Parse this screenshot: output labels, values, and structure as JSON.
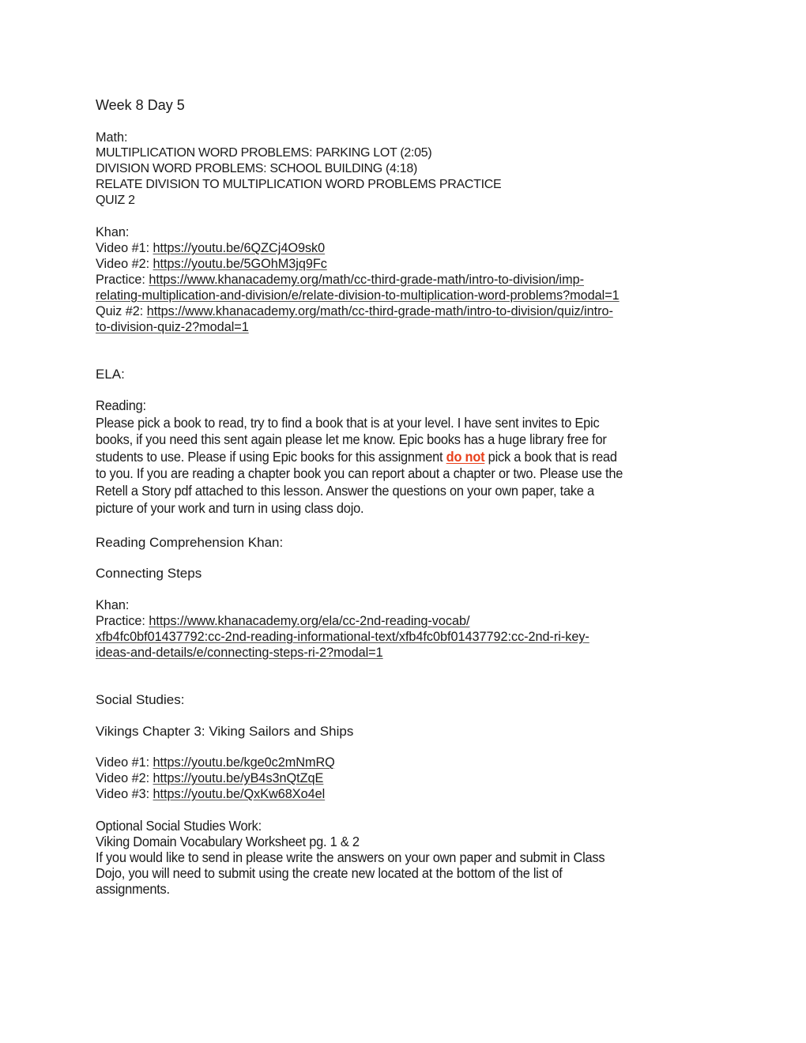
{
  "document": {
    "title": "Week 8 Day 5",
    "math": {
      "heading": "Math:",
      "items": [
        "MULTIPLICATION WORD PROBLEMS: PARKING LOT (2:05)",
        "DIVISION WORD PROBLEMS: SCHOOL BUILDING (4:18)",
        "RELATE DIVISION TO MULTIPLICATION WORD PROBLEMS PRACTICE",
        "QUIZ 2"
      ],
      "khan_heading": "Khan:",
      "video1_label": "Video #1: ",
      "video1_url": "https://youtu.be/6QZCj4O9sk0",
      "video2_label": "Video #2: ",
      "video2_url": "https://youtu.be/5GOhM3jq9Fc",
      "practice_label": "Practice: ",
      "practice_url_line1": "https://www.khanacademy.org/math/cc-third-grade-math/intro-to-division/imp-",
      "practice_url_line2": "relating-multiplication-and-division/e/relate-division-to-multiplication-word-problems?modal=1",
      "quiz_label": "Quiz #2: ",
      "quiz_url_line1": "https://www.khanacademy.org/math/cc-third-grade-math/intro-to-division/quiz/intro-",
      "quiz_url_line2": "to-division-quiz-2?modal=1"
    },
    "ela": {
      "heading": "ELA:",
      "reading_heading": "Reading:",
      "reading_lines": [
        "Please pick a book to read, try to find a book that is at your level. I have sent invites to Epic",
        "books, if you need this sent again please let me know. Epic books has a huge library free for"
      ],
      "reading_line3_before": "students to use. Please if using Epic books for this assignment ",
      "reading_emphasis": "do not",
      "reading_line3_after": " pick a book that is read",
      "reading_lines_end": [
        "to you. If you are reading a chapter book you can report about a chapter or two. Please use the",
        "Retell a Story pdf attached to this lesson. Answer the questions on your own paper, take a",
        "picture of your work and turn in using class dojo."
      ],
      "comprehension_heading": "Reading Comprehension Khan:",
      "topic": "Connecting Steps",
      "khan_heading": "Khan:",
      "practice_label": "Practice: ",
      "practice_url_line1": "https://www.khanacademy.org/ela/cc-2nd-reading-vocab/",
      "practice_url_line2": "xfb4fc0bf01437792:cc-2nd-reading-informational-text/xfb4fc0bf01437792:cc-2nd-ri-key-",
      "practice_url_line3": "ideas-and-details/e/connecting-steps-ri-2?modal=1"
    },
    "social_studies": {
      "heading": "Social Studies:",
      "chapter": "Vikings Chapter 3: Viking Sailors and Ships",
      "video1_label": "Video #1: ",
      "video1_url": "https://youtu.be/kge0c2mNmRQ",
      "video2_label": "Video #2: ",
      "video2_url": "https://youtu.be/yB4s3nQtZqE",
      "video3_label": "Video #3: ",
      "video3_url": "https://youtu.be/QxKw68Xo4el",
      "optional_heading": "Optional Social Studies Work:",
      "worksheet": "Viking Domain Vocabulary Worksheet pg. 1 & 2",
      "instructions_lines": [
        "If you would like to send in please write the answers on your own paper and submit in Class",
        "Dojo, you will need to submit using the create new located at the bottom of the list of",
        "assignments."
      ]
    },
    "colors": {
      "emphasis": "#e8401c",
      "text": "#1a1a1a"
    }
  }
}
